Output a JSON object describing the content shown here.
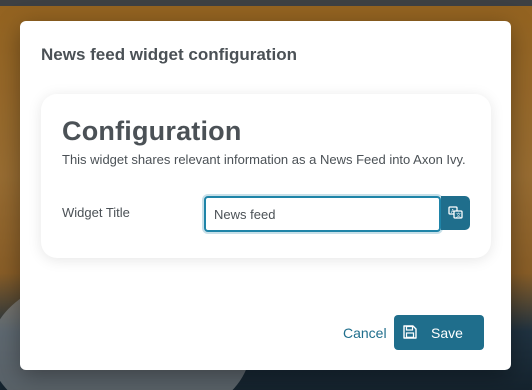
{
  "dialog": {
    "title": "News feed widget configuration"
  },
  "card": {
    "heading": "Configuration",
    "description": "This widget shares relevant information as a News Feed into Axon Ivy."
  },
  "form": {
    "widget_title_label": "Widget Title",
    "widget_title_value": "News feed"
  },
  "footer": {
    "cancel_label": "Cancel",
    "save_label": "Save"
  },
  "icons": {
    "translate": "translate-icon",
    "save": "floppy-disk-icon"
  },
  "colors": {
    "accent": "#1f6e8c",
    "focus_border": "#1f84a8",
    "text": "#4b5156"
  }
}
